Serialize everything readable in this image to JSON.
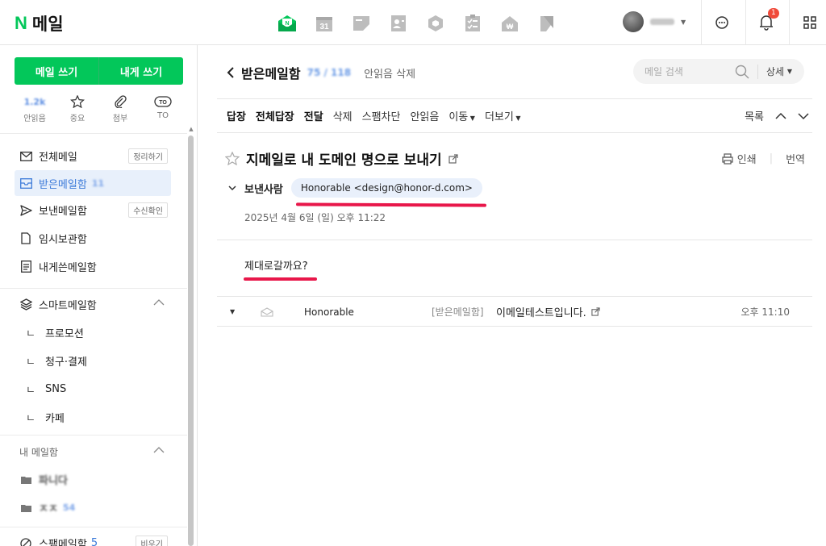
{
  "app": {
    "logo_letter": "N",
    "title": "메일"
  },
  "apps": [
    {
      "name": "mail-app-icon"
    },
    {
      "name": "calendar-app-icon",
      "label": "31"
    },
    {
      "name": "memo-app-icon"
    },
    {
      "name": "contacts-app-icon"
    },
    {
      "name": "mybox-app-icon"
    },
    {
      "name": "todo-app-icon"
    },
    {
      "name": "household-app-icon"
    },
    {
      "name": "bookmark-app-icon"
    }
  ],
  "header": {
    "notification_count": "1"
  },
  "sidebar": {
    "compose_label": "메일 쓰기",
    "self_compose_label": "내게 쓰기",
    "quick": [
      {
        "label": "안읽음",
        "value": "1.2k"
      },
      {
        "label": "중요"
      },
      {
        "label": "첨부"
      },
      {
        "label": "TO",
        "icon_text": "TO"
      }
    ],
    "folders": [
      {
        "label": "전체메일",
        "tag": "정리하기"
      },
      {
        "label": "받은메일함",
        "count": "11"
      },
      {
        "label": "보낸메일함",
        "tag": "수신확인"
      },
      {
        "label": "임시보관함"
      },
      {
        "label": "내게쓴메일함"
      }
    ],
    "smart_label": "스마트메일함",
    "smart_items": [
      "프로모션",
      "청구·결제",
      "SNS",
      "카페"
    ],
    "sub_prefix": "ㄴ",
    "my_folders_label": "내 메일함",
    "my_folders": [
      {
        "label": "파니다"
      },
      {
        "label": "ㅈㅈ",
        "count": "54"
      }
    ],
    "spam": {
      "label": "스팸메일함",
      "count": "5",
      "action": "비우기"
    }
  },
  "main": {
    "mailbox_title": "받은메일함",
    "mailbox_count": "75 / 118",
    "delete_unread": "안읽음 삭제",
    "search_placeholder": "메일 검색",
    "search_detail": "상세",
    "toolbar": {
      "reply": "답장",
      "reply_all": "전체답장",
      "forward": "전달",
      "delete": "삭제",
      "spam": "스팸차단",
      "unread": "안읽음",
      "move": "이동",
      "more": "더보기",
      "list": "목록"
    },
    "message": {
      "subject": "지메일로 내 도메인 명으로 보내기",
      "print": "인쇄",
      "translate": "번역",
      "sender_label": "보낸사람",
      "sender": "Honorable <design@honor-d.com>",
      "date": "2025년 4월 6일 (일) 오후 11:22",
      "body": "제대로갈까요?"
    },
    "thread": {
      "from": "Honorable",
      "folder": "[받은메일함]",
      "subject": "이메일테스트입니다.",
      "time": "오후 11:10"
    }
  },
  "colors": {
    "brand": "#03c75a",
    "accent": "#3b7ad9",
    "annotation": "#e8174a"
  }
}
